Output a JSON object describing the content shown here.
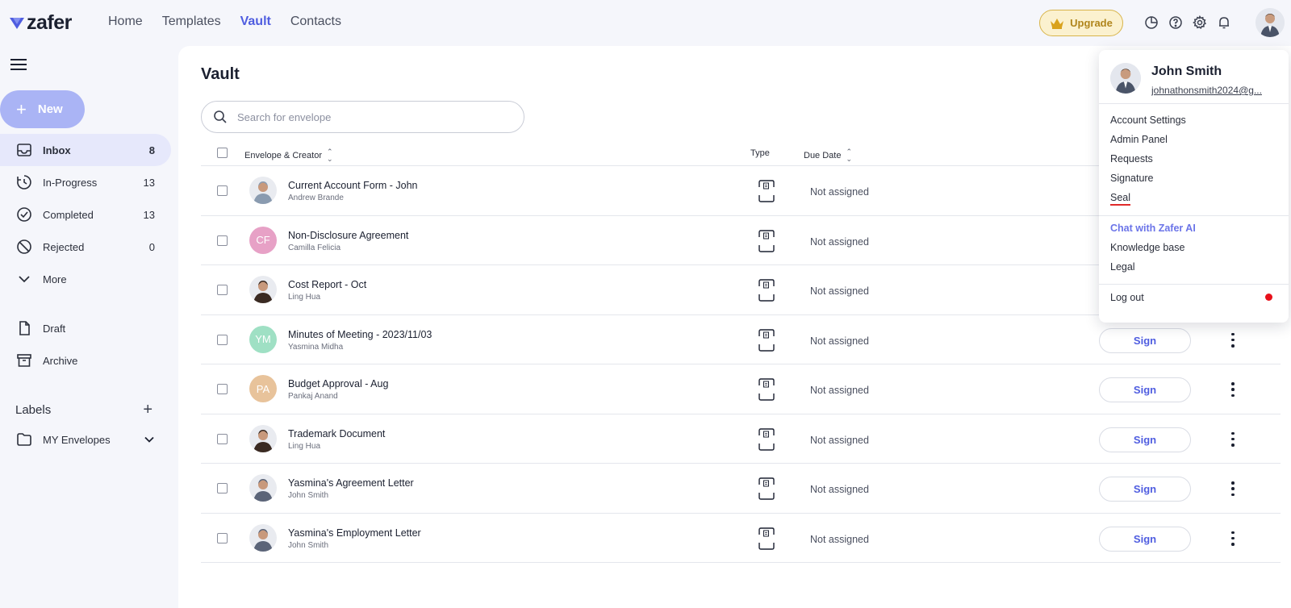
{
  "app": {
    "logo_text": "zafer",
    "brand_color": "#4f5de0"
  },
  "topnav": {
    "items": [
      {
        "label": "Home",
        "active": false
      },
      {
        "label": "Templates",
        "active": false
      },
      {
        "label": "Vault",
        "active": true
      },
      {
        "label": "Contacts",
        "active": false
      }
    ],
    "upgrade_label": "Upgrade",
    "icons": [
      "analytics-icon",
      "help-icon",
      "gear-icon",
      "bell-icon"
    ]
  },
  "sidebar": {
    "new_label": "New",
    "items": [
      {
        "label": "Inbox",
        "count": "8",
        "icon": "inbox-icon",
        "active": true
      },
      {
        "label": "In-Progress",
        "count": "13",
        "icon": "clock-icon",
        "active": false
      },
      {
        "label": "Completed",
        "count": "13",
        "icon": "check-circle-icon",
        "active": false
      },
      {
        "label": "Rejected",
        "count": "0",
        "icon": "ban-icon",
        "active": false
      },
      {
        "label": "More",
        "count": "",
        "icon": "chevron-down-icon",
        "active": false
      }
    ],
    "items2": [
      {
        "label": "Draft",
        "icon": "file-icon"
      },
      {
        "label": "Archive",
        "icon": "archive-icon"
      }
    ],
    "labels_heading": "Labels",
    "label_items": [
      {
        "label": "MY Envelopes",
        "icon": "folder-icon"
      }
    ]
  },
  "main": {
    "title": "Vault",
    "search_placeholder": "Search for envelope",
    "columns": {
      "envelope": "Envelope & Creator",
      "type": "Type",
      "due": "Due Date"
    },
    "rows": [
      {
        "title": "Current Account Form - John",
        "creator": "Andrew Brande",
        "avatar_kind": "photo",
        "initials": "",
        "avatar_color": "#8a9bb0",
        "type": "DOCUMENT",
        "due": "Not assigned",
        "action": ""
      },
      {
        "title": "Non-Disclosure Agreement",
        "creator": "Camilla Felicia",
        "avatar_kind": "initials",
        "initials": "CF",
        "avatar_color": "#e7a1c6",
        "type": "DOCUMENT",
        "due": "Not assigned",
        "action": ""
      },
      {
        "title": "Cost Report - Oct",
        "creator": "Ling Hua",
        "avatar_kind": "photo",
        "initials": "",
        "avatar_color": "#3a2a22",
        "type": "DOCUMENT",
        "due": "Not assigned",
        "action": ""
      },
      {
        "title": "Minutes of Meeting - 2023/11/03",
        "creator": "Yasmina Midha",
        "avatar_kind": "initials",
        "initials": "YM",
        "avatar_color": "#9fe0c4",
        "type": "DOCUMENT",
        "due": "Not assigned",
        "action": "Sign"
      },
      {
        "title": "Budget Approval - Aug",
        "creator": "Pankaj Anand",
        "avatar_kind": "initials",
        "initials": "PA",
        "avatar_color": "#e8c39b",
        "type": "DYNAMIC",
        "due": "Not assigned",
        "action": "Sign"
      },
      {
        "title": "Trademark Document",
        "creator": "Ling Hua",
        "avatar_kind": "photo",
        "initials": "",
        "avatar_color": "#3a2a22",
        "type": "DOCUMENT",
        "due": "Not assigned",
        "action": "Sign"
      },
      {
        "title": "Yasmina's Agreement Letter",
        "creator": "John Smith",
        "avatar_kind": "photo",
        "initials": "",
        "avatar_color": "#5b6478",
        "type": "DOCUMENT",
        "due": "Not assigned",
        "action": "Sign"
      },
      {
        "title": "Yasmina's Employment Letter",
        "creator": "John Smith",
        "avatar_kind": "photo",
        "initials": "",
        "avatar_color": "#5b6478",
        "type": "DOCUMENT",
        "due": "Not assigned",
        "action": "Sign"
      }
    ]
  },
  "user_menu": {
    "name": "John Smith",
    "email": "johnathonsmith2024@g...",
    "group1": [
      "Account Settings",
      "Admin Panel",
      "Requests",
      "Signature",
      "Seal"
    ],
    "group2": [
      "Chat with Zafer AI",
      "Knowledge base",
      "Legal"
    ],
    "logout": "Log out",
    "status_color": "#e8101a"
  }
}
